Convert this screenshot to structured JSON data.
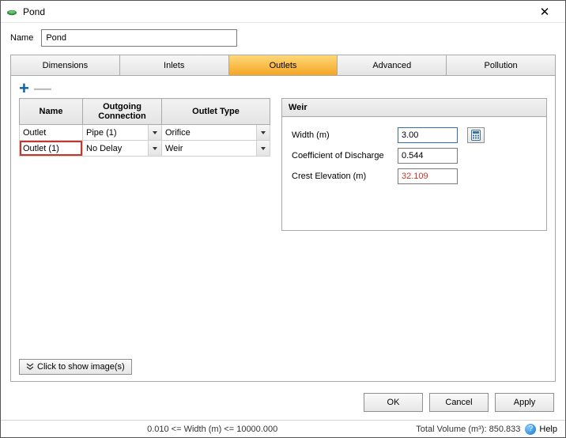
{
  "window": {
    "title": "Pond"
  },
  "name": {
    "label": "Name",
    "value": "Pond"
  },
  "tabs": [
    {
      "label": "Dimensions"
    },
    {
      "label": "Inlets"
    },
    {
      "label": "Outlets"
    },
    {
      "label": "Advanced"
    },
    {
      "label": "Pollution"
    }
  ],
  "grid": {
    "headers": {
      "name": "Name",
      "conn": "Outgoing\nConnection",
      "type": "Outlet Type"
    },
    "rows": [
      {
        "name": "Outlet",
        "conn": "Pipe (1)",
        "type": "Orifice"
      },
      {
        "name": "Outlet (1)",
        "conn": "No Delay",
        "type": "Weir"
      }
    ]
  },
  "panel": {
    "title": "Weir",
    "fields": {
      "width": {
        "label": "Width (m)",
        "value": "3.00"
      },
      "coef": {
        "label": "Coefficient of Discharge",
        "value": "0.544"
      },
      "crest": {
        "label": "Crest Elevation (m)",
        "value": "32.109"
      }
    }
  },
  "showImages": "Click to show image(s)",
  "buttons": {
    "ok": "OK",
    "cancel": "Cancel",
    "apply": "Apply"
  },
  "status": {
    "hint": "0.010 <= Width (m) <= 10000.000",
    "volume": "Total Volume (m³): 850.833",
    "help": "Help"
  }
}
